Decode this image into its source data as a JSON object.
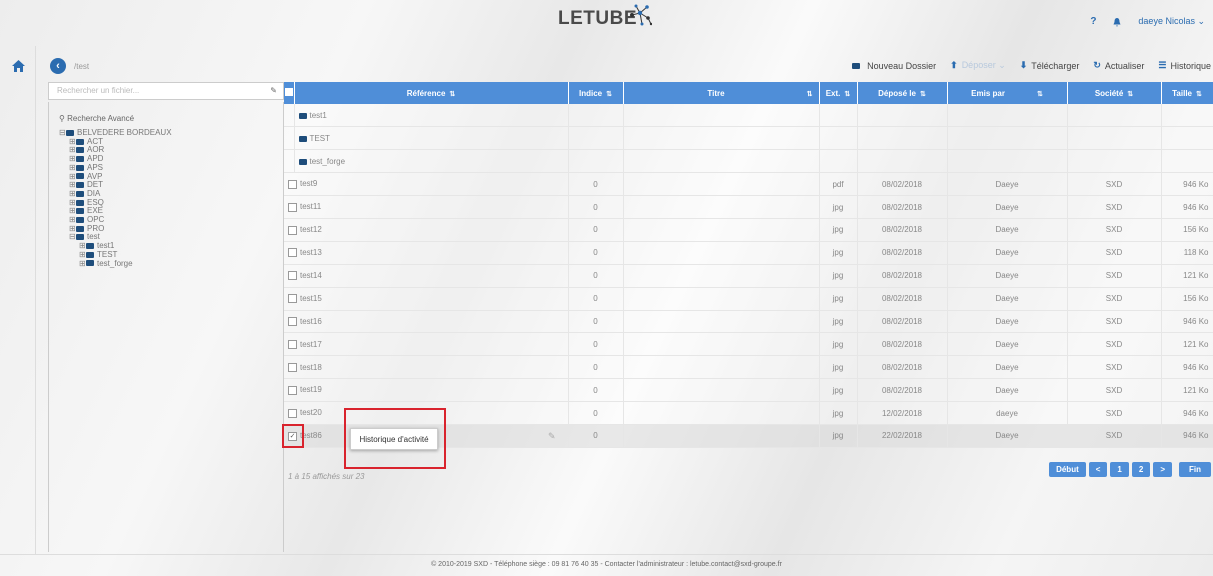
{
  "header": {
    "logo": "LETUBE",
    "help": "?",
    "user": "daeye Nicolas ⌄"
  },
  "path": "/test",
  "toolbar": {
    "new_folder": "Nouveau Dossier",
    "deposit": "Déposer ⌄",
    "download": "Télécharger",
    "refresh": "Actualiser",
    "history": "Historique"
  },
  "search": {
    "placeholder": "Rechercher un fichier..."
  },
  "tree": {
    "advanced_search": "Recherche Avancé",
    "root": "BELVEDERE BORDEAUX",
    "items": [
      "ACT",
      "AOR",
      "APD",
      "APS",
      "AVP",
      "DET",
      "DIA",
      "ESQ",
      "EXE",
      "OPC",
      "PRO"
    ],
    "open_item": "test",
    "children": [
      "test1",
      "TEST",
      "test_forge"
    ]
  },
  "table": {
    "headers": {
      "reference": "Référence",
      "indice": "Indice",
      "titre": "Titre",
      "ext": "Ext.",
      "depose": "Déposé le",
      "emis": "Emis par",
      "societe": "Société",
      "taille": "Taille"
    },
    "folders": [
      "test1",
      "TEST",
      "test_forge"
    ],
    "rows": [
      [
        "test9",
        "0",
        "",
        "pdf",
        "08/02/2018",
        "Daeye",
        "SXD",
        "946 Ko"
      ],
      [
        "test11",
        "0",
        "",
        "jpg",
        "08/02/2018",
        "Daeye",
        "SXD",
        "946 Ko"
      ],
      [
        "test12",
        "0",
        "",
        "jpg",
        "08/02/2018",
        "Daeye",
        "SXD",
        "156 Ko"
      ],
      [
        "test13",
        "0",
        "",
        "jpg",
        "08/02/2018",
        "Daeye",
        "SXD",
        "118 Ko"
      ],
      [
        "test14",
        "0",
        "",
        "jpg",
        "08/02/2018",
        "Daeye",
        "SXD",
        "121 Ko"
      ],
      [
        "test15",
        "0",
        "",
        "jpg",
        "08/02/2018",
        "Daeye",
        "SXD",
        "156 Ko"
      ],
      [
        "test16",
        "0",
        "",
        "jpg",
        "08/02/2018",
        "Daeye",
        "SXD",
        "946 Ko"
      ],
      [
        "test17",
        "0",
        "",
        "jpg",
        "08/02/2018",
        "Daeye",
        "SXD",
        "121 Ko"
      ],
      [
        "test18",
        "0",
        "",
        "jpg",
        "08/02/2018",
        "Daeye",
        "SXD",
        "946 Ko"
      ],
      [
        "test19",
        "0",
        "",
        "jpg",
        "08/02/2018",
        "Daeye",
        "SXD",
        "121 Ko"
      ],
      [
        "test20",
        "0",
        "",
        "jpg",
        "12/02/2018",
        "daeye",
        "SXD",
        "946 Ko"
      ],
      [
        "test86",
        "0",
        "",
        "jpg",
        "22/02/2018",
        "Daeye",
        "SXD",
        "946 Ko"
      ]
    ]
  },
  "tooltip": "Historique d'activité",
  "count": "1 à 15 affichés sur 23",
  "pager": [
    "Début",
    "<",
    "1",
    "2",
    ">",
    "Fin"
  ],
  "footer": "© 2010-2019 SXD - Téléphone siège : 09 81 76 40 35 - Contacter l'administrateur : letube.contact@sxd-groupe.fr"
}
